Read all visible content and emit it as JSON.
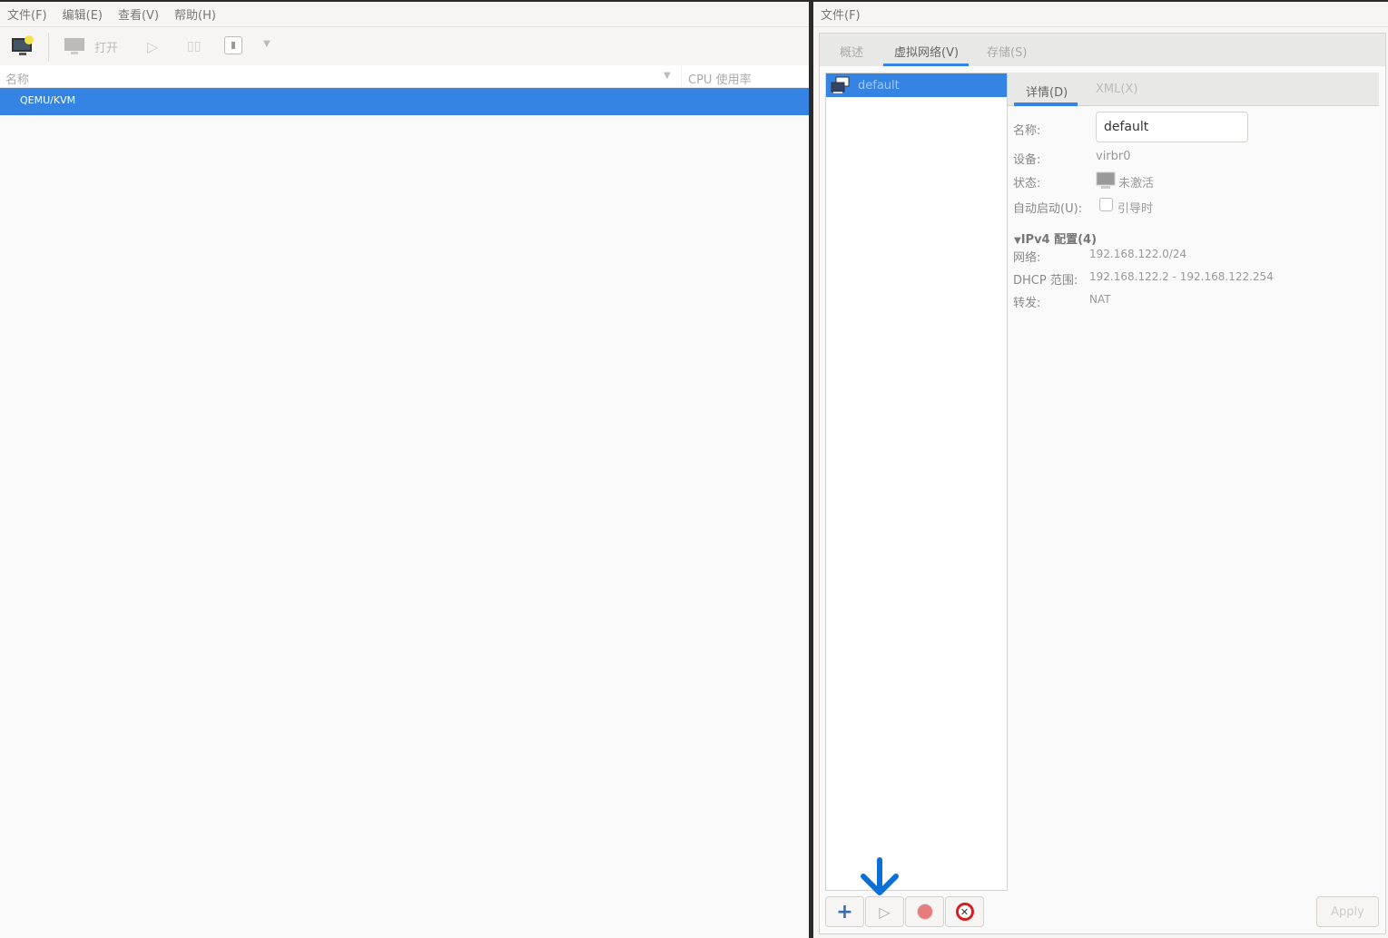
{
  "left": {
    "menu": [
      "文件(F)",
      "编辑(E)",
      "查看(V)",
      "帮助(H)"
    ],
    "toolbar": {
      "open_label": "打开"
    },
    "columns": {
      "name": "名称",
      "cpu": "CPU 使用率"
    },
    "rows": [
      {
        "name": "QEMU/KVM",
        "selected": true
      }
    ]
  },
  "right": {
    "menu": [
      "文件(F)"
    ],
    "tabs": [
      "概述",
      "虚拟网络(V)",
      "存储(S)"
    ],
    "active_tab": 1,
    "networks": [
      {
        "name": "default",
        "selected": true
      }
    ],
    "detail_tabs": [
      "详情(D)",
      "XML(X)"
    ],
    "details": {
      "name_label": "名称:",
      "name_value": "default",
      "device_label": "设备:",
      "device_value": "virbr0",
      "state_label": "状态:",
      "state_value": "未激活",
      "autostart_label": "自动启动(U):",
      "autostart_option": "引导时",
      "autostart_checked": false
    },
    "ipv4": {
      "header": "IPv4 配置(4)",
      "network_label": "网络:",
      "network_value": "192.168.122.0/24",
      "dhcp_label": "DHCP 范围:",
      "dhcp_value": "192.168.122.2 - 192.168.122.254",
      "forward_label": "转发:",
      "forward_value": "NAT"
    },
    "apply_label": "Apply"
  },
  "colors": {
    "accent": "#3584e4",
    "annotation_arrow": "#0a6fd6"
  }
}
